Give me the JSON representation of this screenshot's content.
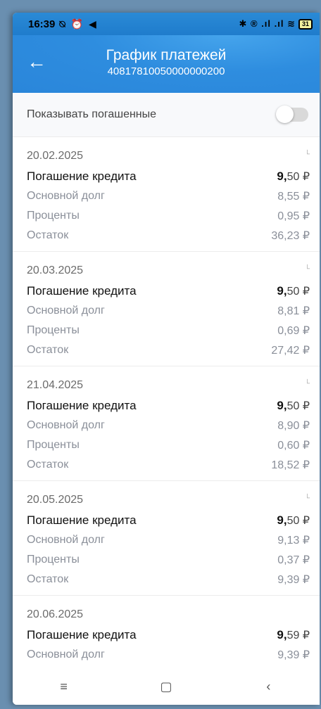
{
  "status": {
    "time": "16:39",
    "left_icons": "⍉ ⏰ ◀",
    "right_icons": "✱ ® .ıl .ıl ≋",
    "battery": "31"
  },
  "header": {
    "title": "График платежей",
    "subtitle": "40817810050000000200",
    "back_icon": "←"
  },
  "toggle": {
    "label": "Показывать погашенные",
    "state": "off"
  },
  "labels": {
    "payment": "Погашение кредита",
    "principal": "Основной долг",
    "interest": "Проценты",
    "remaining": "Остаток"
  },
  "payments": [
    {
      "date": "20.02.2025",
      "amount_int": "9,",
      "amount_frac": "50 ₽",
      "principal": "8,55 ₽",
      "interest": "0,95 ₽",
      "remaining": "36,23 ₽"
    },
    {
      "date": "20.03.2025",
      "amount_int": "9,",
      "amount_frac": "50 ₽",
      "principal": "8,81 ₽",
      "interest": "0,69 ₽",
      "remaining": "27,42 ₽"
    },
    {
      "date": "21.04.2025",
      "amount_int": "9,",
      "amount_frac": "50 ₽",
      "principal": "8,90 ₽",
      "interest": "0,60 ₽",
      "remaining": "18,52 ₽"
    },
    {
      "date": "20.05.2025",
      "amount_int": "9,",
      "amount_frac": "50 ₽",
      "principal": "9,13 ₽",
      "interest": "0,37 ₽",
      "remaining": "9,39 ₽"
    },
    {
      "date": "20.06.2025",
      "amount_int": "9,",
      "amount_frac": "59 ₽",
      "principal": "9,39 ₽"
    }
  ],
  "navbar": {
    "menu_icon": "≡",
    "home_icon": "▢",
    "back_icon": "‹"
  }
}
